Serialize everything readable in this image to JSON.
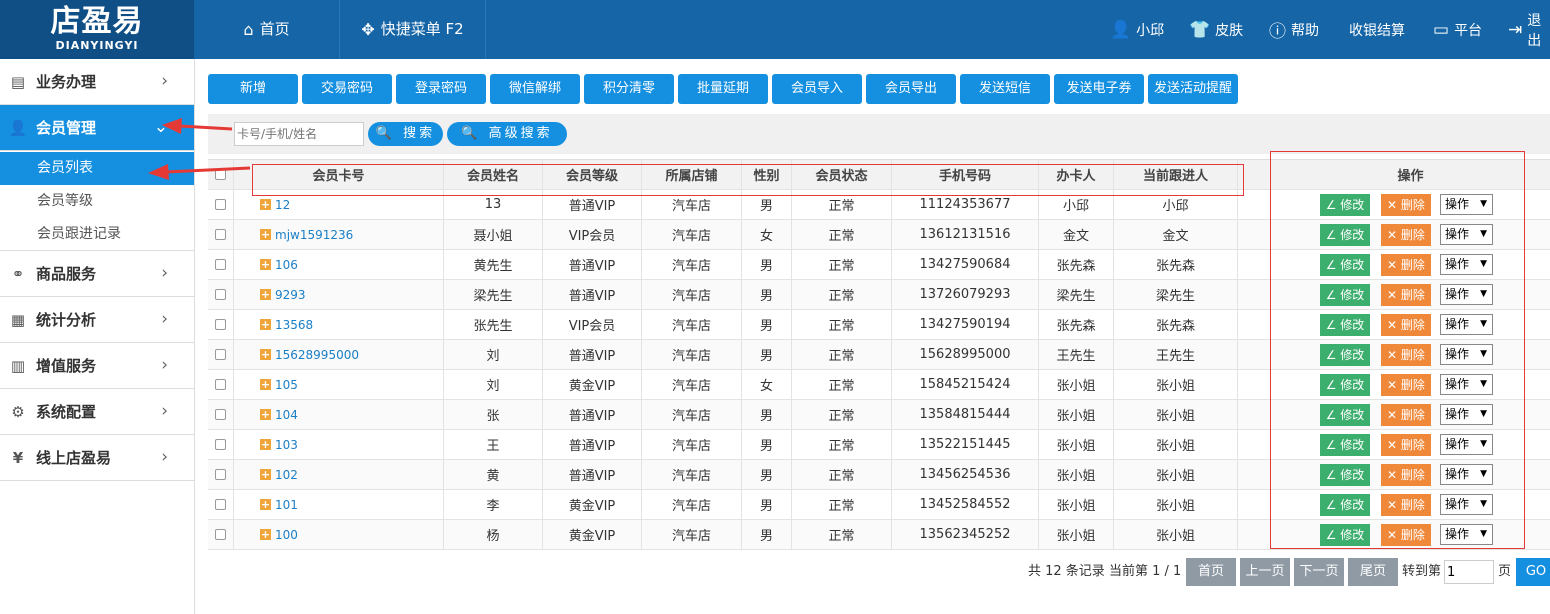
{
  "logo": {
    "cn": "店盈易",
    "en": "DIANYINGYI"
  },
  "topnav": {
    "home": "首页",
    "quick_menu": "快捷菜单 F2"
  },
  "topright": {
    "user": "小邱",
    "skin": "皮肤",
    "help": "帮助",
    "checkout": "收银结算",
    "platform": "平台",
    "logout": "退出"
  },
  "sidebar": {
    "menus": [
      "业务办理",
      "会员管理",
      "商品服务",
      "统计分析",
      "增值服务",
      "系统配置",
      "线上店盈易"
    ],
    "submenu": [
      "会员列表",
      "会员等级",
      "会员跟进记录"
    ]
  },
  "toolbar": [
    "新增",
    "交易密码",
    "登录密码",
    "微信解绑",
    "积分清零",
    "批量延期",
    "会员导入",
    "会员导出",
    "发送短信",
    "发送电子券",
    "发送活动提醒"
  ],
  "search": {
    "placeholder": "卡号/手机/姓名",
    "search_label": "搜索",
    "advanced_label": "高级搜索"
  },
  "table": {
    "headers": [
      "会员卡号",
      "会员姓名",
      "会员等级",
      "所属店铺",
      "性别",
      "会员状态",
      "手机号码",
      "办卡人",
      "当前跟进人",
      "操作"
    ],
    "edit_label": "修改",
    "delete_label": "删除",
    "op_label": "操作",
    "rows": [
      [
        "12",
        "13",
        "普通VIP",
        "汽车店",
        "男",
        "正常",
        "11124353677",
        "小邱",
        "小邱"
      ],
      [
        "mjw1591236",
        "聂小姐",
        "VIP会员",
        "汽车店",
        "女",
        "正常",
        "13612131516",
        "金文",
        "金文"
      ],
      [
        "106",
        "黄先生",
        "普通VIP",
        "汽车店",
        "男",
        "正常",
        "13427590684",
        "张先森",
        "张先森"
      ],
      [
        "9293",
        "梁先生",
        "普通VIP",
        "汽车店",
        "男",
        "正常",
        "13726079293",
        "梁先生",
        "梁先生"
      ],
      [
        "13568",
        "张先生",
        "VIP会员",
        "汽车店",
        "男",
        "正常",
        "13427590194",
        "张先森",
        "张先森"
      ],
      [
        "15628995000",
        "刘",
        "普通VIP",
        "汽车店",
        "男",
        "正常",
        "15628995000",
        "王先生",
        "王先生"
      ],
      [
        "105",
        "刘",
        "黄金VIP",
        "汽车店",
        "女",
        "正常",
        "15845215424",
        "张小姐",
        "张小姐"
      ],
      [
        "104",
        "张",
        "普通VIP",
        "汽车店",
        "男",
        "正常",
        "13584815444",
        "张小姐",
        "张小姐"
      ],
      [
        "103",
        "王",
        "普通VIP",
        "汽车店",
        "男",
        "正常",
        "13522151445",
        "张小姐",
        "张小姐"
      ],
      [
        "102",
        "黄",
        "普通VIP",
        "汽车店",
        "男",
        "正常",
        "13456254536",
        "张小姐",
        "张小姐"
      ],
      [
        "101",
        "李",
        "黄金VIP",
        "汽车店",
        "男",
        "正常",
        "13452584552",
        "张小姐",
        "张小姐"
      ],
      [
        "100",
        "杨",
        "黄金VIP",
        "汽车店",
        "男",
        "正常",
        "13562345252",
        "张小姐",
        "张小姐"
      ]
    ]
  },
  "pager": {
    "summary": "共 12 条记录 当前第 1 / 1",
    "first": "首页",
    "prev": "上一页",
    "next": "下一页",
    "last": "尾页",
    "goto": "转到第",
    "page_value": "1",
    "page_unit": "页",
    "go": "GO"
  },
  "colors": {
    "topbar": "#1565a7",
    "accent": "#1590e0",
    "edit": "#3cae6d",
    "delete": "#f0883a",
    "annotation": "#e53935"
  }
}
